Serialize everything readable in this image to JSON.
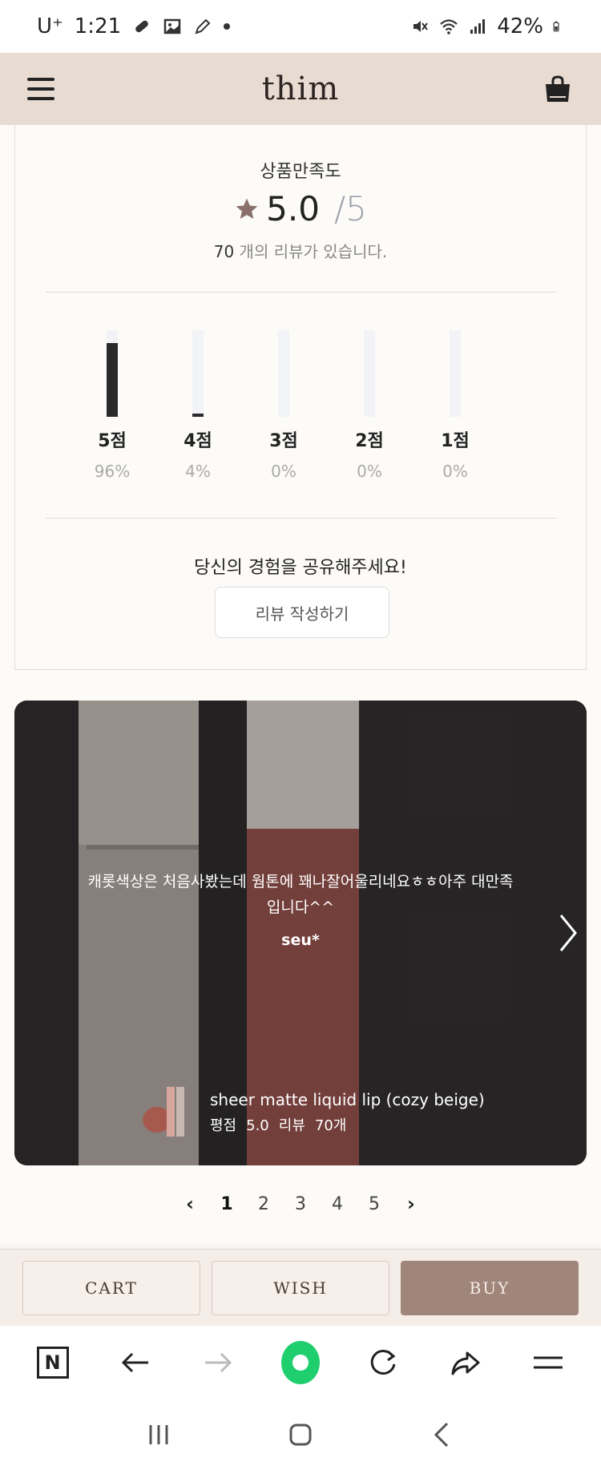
{
  "status_bar": {
    "carrier": "U⁺",
    "time": "1:21",
    "battery": "42%"
  },
  "header": {
    "brand": "thim"
  },
  "summary": {
    "title": "상품만족도",
    "rating": "5.0",
    "rating_max": "/5",
    "review_count_num": "70",
    "review_count_suffix": " 개의 리뷰가 있습니다.",
    "distribution": [
      {
        "label": "5점",
        "pct_text": "96%",
        "fraction": 0.96
      },
      {
        "label": "4점",
        "pct_text": "4%",
        "fraction": 0.04
      },
      {
        "label": "3점",
        "pct_text": "0%",
        "fraction": 0.0
      },
      {
        "label": "2점",
        "pct_text": "0%",
        "fraction": 0.0
      },
      {
        "label": "1점",
        "pct_text": "0%",
        "fraction": 0.0
      }
    ],
    "cta_text": "당신의 경험을 공유해주세요!",
    "write_button": "리뷰 작성하기"
  },
  "review_card": {
    "text": "캐롯색상은 처음사봤는데 웜톤에 꽤나잘어울리네요ㅎㅎ아주 대만족입니다^^",
    "reviewer": "seu*",
    "product_name": "sheer matte liquid lip (cozy beige)",
    "score_label": "평점",
    "score_value": "5.0",
    "reviews_label": "리뷰",
    "reviews_value": "70개"
  },
  "pagination": {
    "pages": [
      "1",
      "2",
      "3",
      "4",
      "5"
    ],
    "active": "1"
  },
  "actions": {
    "cart": "CART",
    "wish": "WISH",
    "buy": "BUY"
  },
  "browser_toolbar": {
    "n_label": "N"
  },
  "colors": {
    "header_bg": "#e8dbd1",
    "buy_bg": "#a0857a",
    "accent_green": "#1fcf6e"
  },
  "icons": [
    "hamburger-menu-icon",
    "shopping-bag-icon",
    "star-icon",
    "chevron-right-icon",
    "back-arrow-icon",
    "forward-arrow-icon",
    "refresh-icon",
    "share-icon",
    "menu-lines-icon"
  ]
}
